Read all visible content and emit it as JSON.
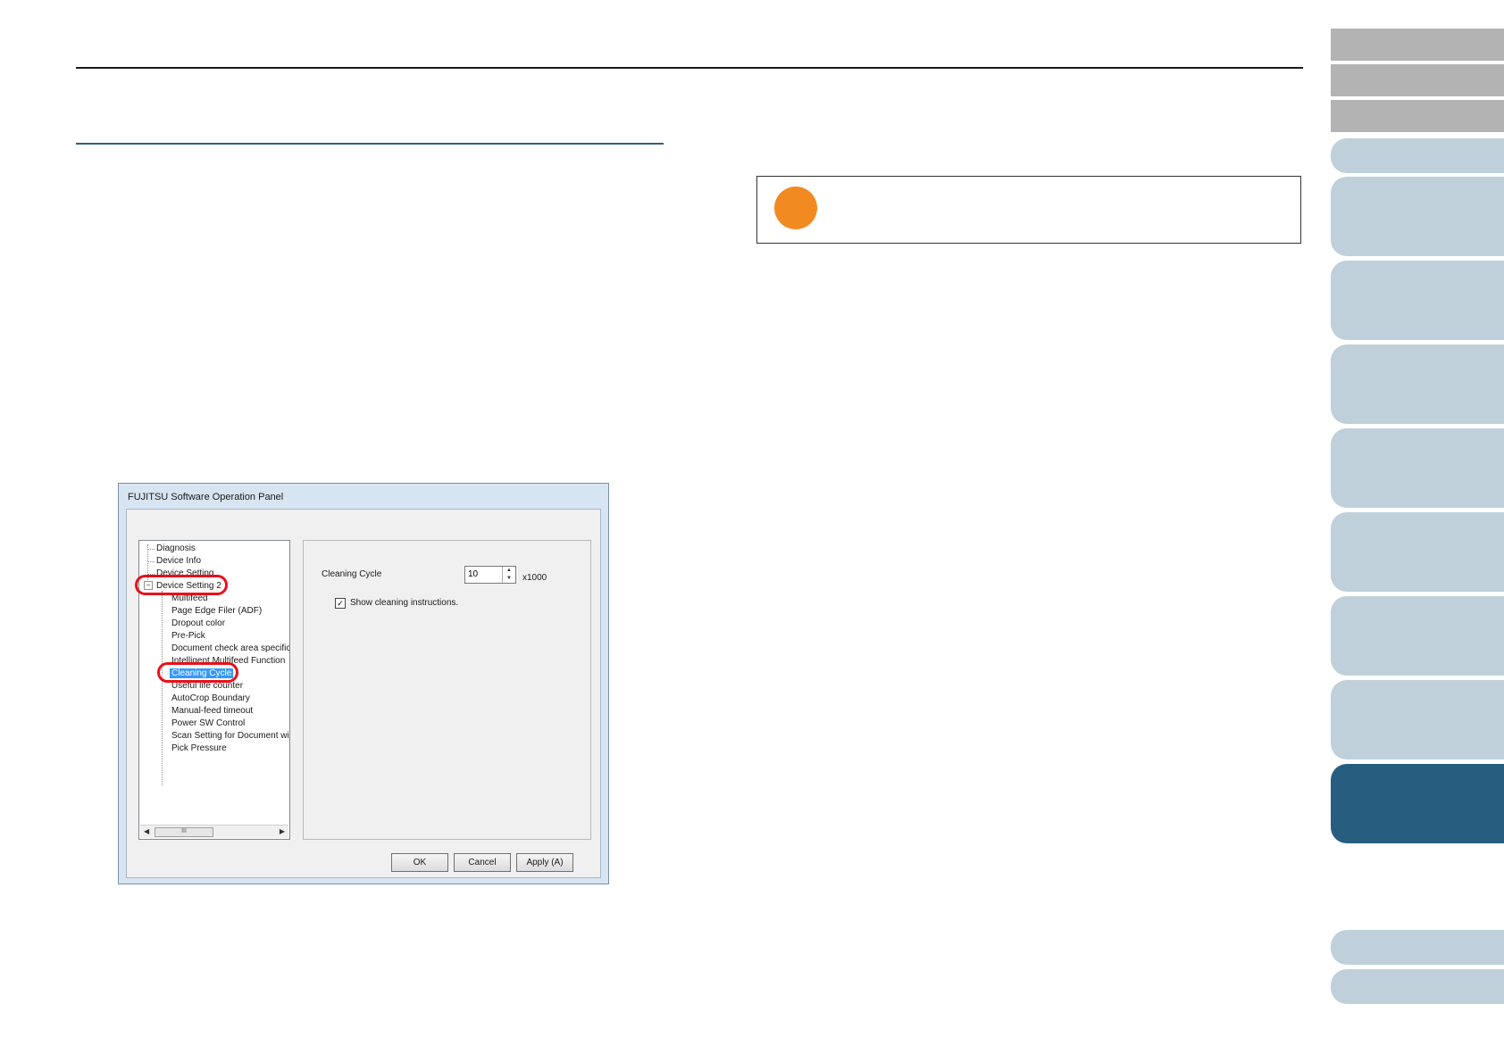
{
  "dialog": {
    "title": "FUJITSU Software Operation Panel",
    "tree": [
      "Diagnosis",
      "Device Info",
      "Device Setting",
      "Device Setting 2",
      "Multifeed",
      "Page Edge Filer (ADF)",
      "Dropout color",
      "Pre-Pick",
      "Document check area specific",
      "Intelligent Multifeed Function",
      "Cleaning Cycle",
      "Useful life counter",
      "AutoCrop Boundary",
      "Manual-feed timeout",
      "Power SW Control",
      "Scan Setting for Document wit",
      "Pick Pressure"
    ],
    "expander_symbol": "−",
    "scroll_thumb_label": "III",
    "panel": {
      "cleaning_cycle_label": "Cleaning Cycle",
      "cleaning_cycle_value": "10",
      "unit": "x1000",
      "show_instructions_label": "Show cleaning instructions.",
      "show_instructions_checked": true
    },
    "buttons": {
      "ok": "OK",
      "cancel": "Cancel",
      "apply": "Apply (A)"
    }
  },
  "colors": {
    "tab_gray": "#b3b3b3",
    "tab_light": "#bfd0da",
    "tab_active": "#275e7f",
    "note_dot": "#f28a22",
    "highlight_ring": "#e8101a"
  }
}
